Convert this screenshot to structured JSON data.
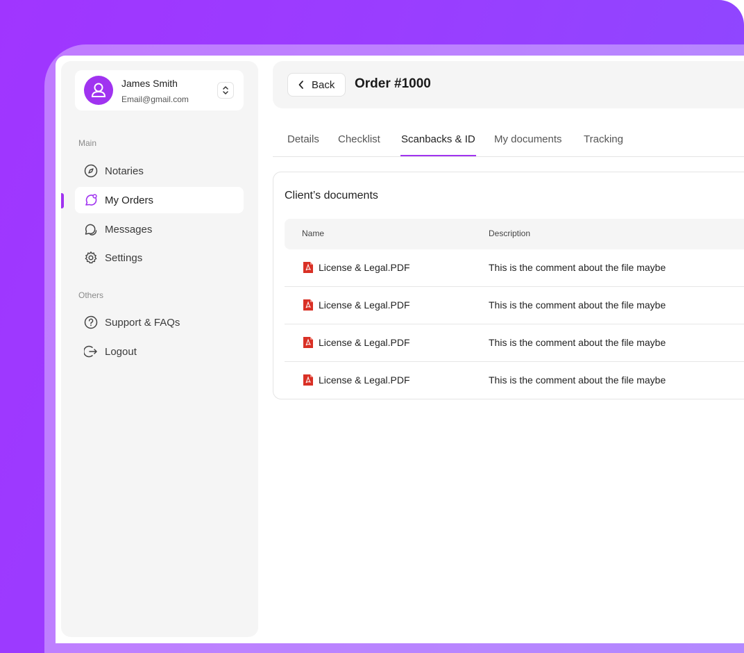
{
  "user": {
    "name": "James Smith",
    "email": "Email@gmail.com"
  },
  "sidebar": {
    "main_label": "Main",
    "others_label": "Others",
    "main_items": [
      {
        "label": "Notaries",
        "icon": "compass-icon"
      },
      {
        "label": "My Orders",
        "icon": "orders-icon",
        "active": true
      },
      {
        "label": "Messages",
        "icon": "messages-icon"
      },
      {
        "label": "Settings",
        "icon": "gear-icon"
      }
    ],
    "other_items": [
      {
        "label": "Support & FAQs",
        "icon": "help-icon"
      },
      {
        "label": "Logout",
        "icon": "logout-icon"
      }
    ]
  },
  "header": {
    "back_label": "Back",
    "title": "Order #1000"
  },
  "tabs": [
    {
      "label": "Details"
    },
    {
      "label": "Checklist"
    },
    {
      "label": "Scanbacks & ID",
      "active": true
    },
    {
      "label": "My documents"
    },
    {
      "label": "Tracking"
    }
  ],
  "documents": {
    "title": "Client’s documents",
    "columns": [
      "Name",
      "Description"
    ],
    "rows": [
      {
        "name": "License & Legal.PDF",
        "description": "This is the comment about the file maybe"
      },
      {
        "name": "License & Legal.PDF",
        "description": "This is the comment about the file maybe"
      },
      {
        "name": "License & Legal.PDF",
        "description": "This is the comment about the file maybe"
      },
      {
        "name": "License & Legal.PDF",
        "description": "This is the comment about the file maybe"
      }
    ]
  },
  "colors": {
    "accent": "#a033f0",
    "pdf_red": "#d93025",
    "panel": "#f5f5f5"
  }
}
